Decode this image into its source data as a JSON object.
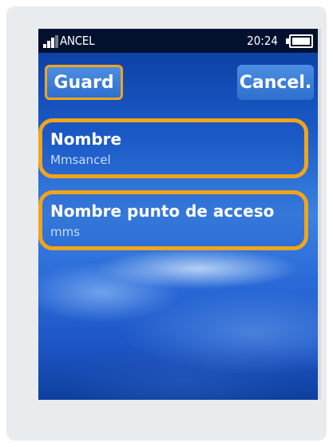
{
  "status_bar": {
    "carrier": "ANCEL",
    "time": "20:24",
    "signal_icon": "signal-bars-icon",
    "battery_icon": "battery-icon"
  },
  "softkeys": {
    "save_label": "Guard",
    "cancel_label": "Cancel."
  },
  "fields": [
    {
      "label": "Nombre",
      "value": "Mmsancel"
    },
    {
      "label": "Nombre punto de acceso",
      "value": "mms"
    }
  ],
  "colors": {
    "highlight": "#f2a41a",
    "status_bar_bg": "#03112e",
    "screen_blue": "#1a5bc8"
  }
}
